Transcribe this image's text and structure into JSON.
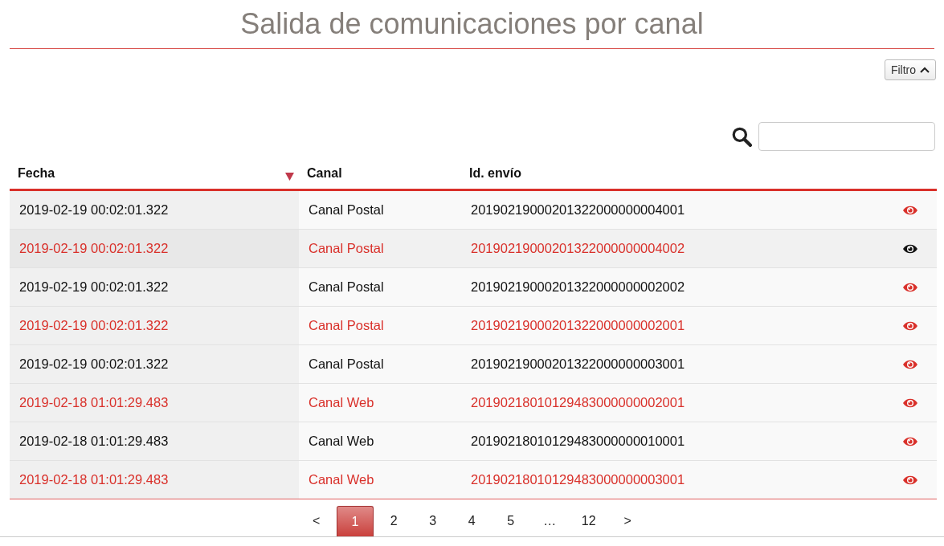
{
  "title": "Salida de comunicaciones por canal",
  "filter_button": {
    "label": "Filtro",
    "expanded": true
  },
  "table": {
    "columns": [
      {
        "label": "Fecha",
        "sorted": true
      },
      {
        "label": "Canal",
        "sorted": false
      },
      {
        "label": "Id. envío",
        "sorted": false
      }
    ],
    "rows": [
      {
        "fecha": "2019-02-19 00:02:01.322",
        "canal": "Canal Postal",
        "id": "20190219000201322000000004001",
        "highlighted": false,
        "selected": false
      },
      {
        "fecha": "2019-02-19 00:02:01.322",
        "canal": "Canal Postal",
        "id": "20190219000201322000000004002",
        "highlighted": true,
        "selected": true
      },
      {
        "fecha": "2019-02-19 00:02:01.322",
        "canal": "Canal Postal",
        "id": "20190219000201322000000002002",
        "highlighted": false,
        "selected": false
      },
      {
        "fecha": "2019-02-19 00:02:01.322",
        "canal": "Canal Postal",
        "id": "20190219000201322000000002001",
        "highlighted": true,
        "selected": false
      },
      {
        "fecha": "2019-02-19 00:02:01.322",
        "canal": "Canal Postal",
        "id": "20190219000201322000000003001",
        "highlighted": false,
        "selected": false
      },
      {
        "fecha": "2019-02-18 01:01:29.483",
        "canal": "Canal Web",
        "id": "20190218010129483000000002001",
        "highlighted": true,
        "selected": false
      },
      {
        "fecha": "2019-02-18 01:01:29.483",
        "canal": "Canal Web",
        "id": "20190218010129483000000010001",
        "highlighted": false,
        "selected": false
      },
      {
        "fecha": "2019-02-18 01:01:29.483",
        "canal": "Canal Web",
        "id": "20190218010129483000000003001",
        "highlighted": true,
        "selected": false
      }
    ]
  },
  "pagination": {
    "prev": "<",
    "next": ">",
    "pages": [
      {
        "label": "1",
        "selected": true
      },
      {
        "label": "2",
        "selected": false
      },
      {
        "label": "3",
        "selected": false
      },
      {
        "label": "4",
        "selected": false
      },
      {
        "label": "5",
        "selected": false
      },
      {
        "label": "…",
        "selected": false
      },
      {
        "label": "12",
        "selected": false
      }
    ]
  }
}
